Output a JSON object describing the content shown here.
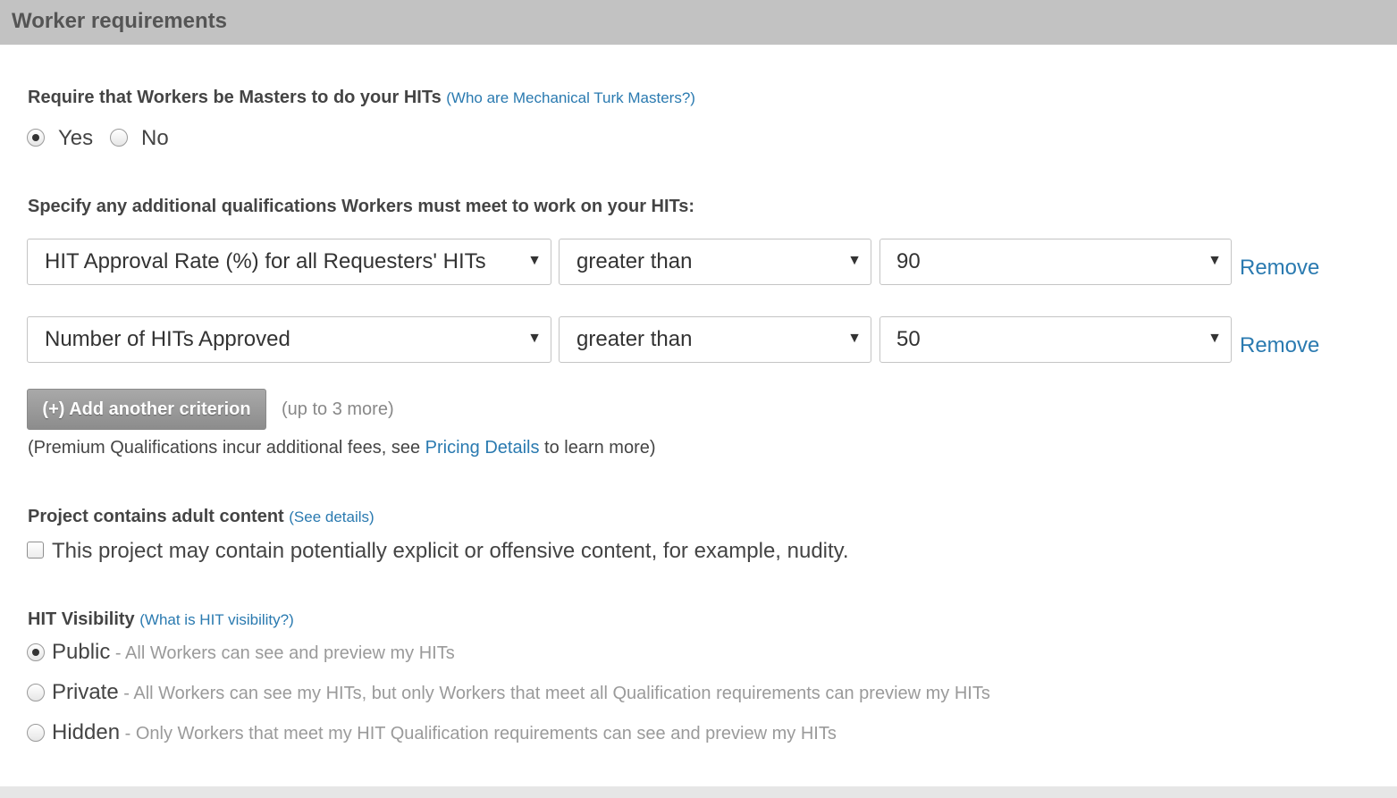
{
  "header": {
    "title": "Worker requirements"
  },
  "masters": {
    "label": "Require that Workers be Masters to do your HITs",
    "help_link": "(Who are Mechanical Turk Masters?)",
    "options": [
      {
        "label": "Yes",
        "checked": true
      },
      {
        "label": "No",
        "checked": false
      }
    ]
  },
  "qualifications": {
    "label": "Specify any additional qualifications Workers must meet to work on your HITs:",
    "rows": [
      {
        "qualification": "HIT Approval Rate (%) for all Requesters' HITs",
        "comparator": "greater than",
        "value": "90",
        "remove": "Remove"
      },
      {
        "qualification": "Number of HITs Approved",
        "comparator": "greater than",
        "value": "50",
        "remove": "Remove"
      }
    ],
    "add_button": "(+) Add another criterion",
    "add_note": "(up to 3 more)",
    "premium_prefix": "(Premium Qualifications incur additional fees, see ",
    "premium_link": "Pricing Details",
    "premium_suffix": " to learn more)"
  },
  "adult": {
    "label": "Project contains adult content",
    "help_link": "(See details)",
    "checkbox_label": "This project may contain potentially explicit or offensive content, for example, nudity.",
    "checked": false
  },
  "visibility": {
    "label": "HIT Visibility",
    "help_link": "(What is HIT visibility?)",
    "options": [
      {
        "label": "Public",
        "desc": " - All Workers can see and preview my HITs",
        "checked": true
      },
      {
        "label": "Private",
        "desc": " - All Workers can see my HITs, but only Workers that meet all Qualification requirements can preview my HITs",
        "checked": false
      },
      {
        "label": "Hidden",
        "desc": " - Only Workers that meet my HIT Qualification requirements can see and preview my HITs",
        "checked": false
      }
    ]
  },
  "icons": {
    "dropdown_arrow": "▼"
  },
  "colors": {
    "header_bg": "#c2c2c2",
    "link": "#2a7ab0",
    "button_bg": "#999999"
  }
}
